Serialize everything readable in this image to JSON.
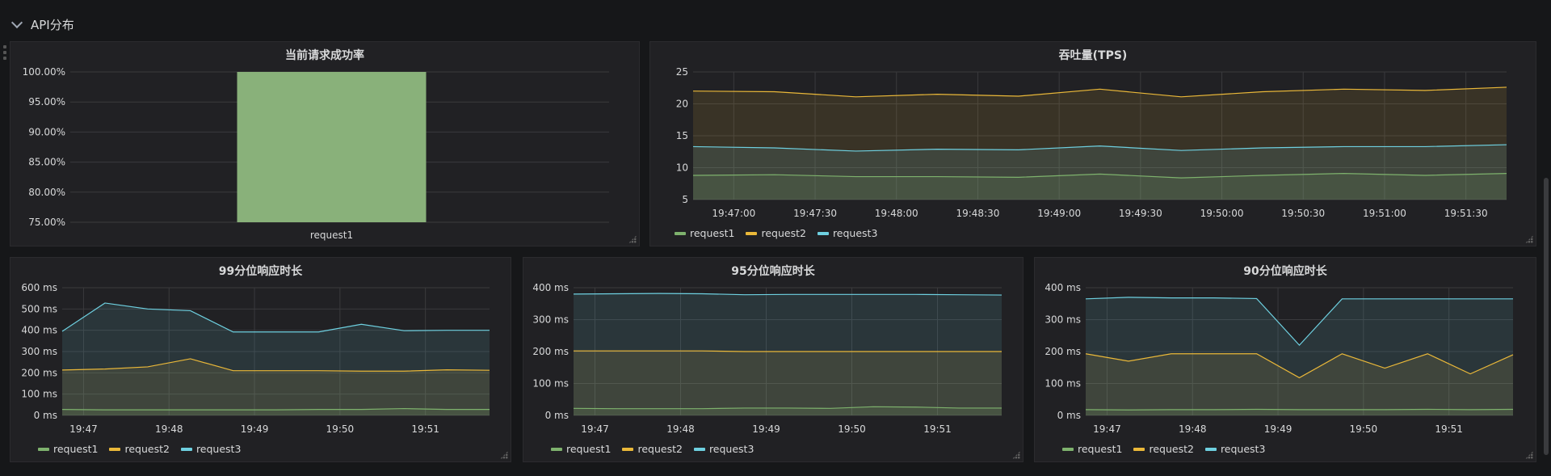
{
  "row": {
    "title": "API分布"
  },
  "colors": {
    "request1": "#7eb26d",
    "request2": "#eab839",
    "request3": "#6ed0e0",
    "bar": "#89b17a"
  },
  "chart_data": [
    {
      "type": "bar",
      "title": "当前请求成功率",
      "categories": [
        "request1"
      ],
      "values": [
        100
      ],
      "ylim": [
        75,
        100
      ],
      "yticks": [
        "75.00%",
        "80.00%",
        "85.00%",
        "90.00%",
        "95.00%",
        "100.00%"
      ],
      "ytick_values": [
        75,
        80,
        85,
        90,
        95,
        100
      ]
    },
    {
      "type": "line",
      "title": "吞吐量(TPS)",
      "x": [
        "19:46:45",
        "19:47:15",
        "19:47:45",
        "19:48:15",
        "19:48:45",
        "19:49:15",
        "19:49:45",
        "19:50:15",
        "19:50:45",
        "19:51:15",
        "19:51:45"
      ],
      "xticks": [
        "19:47:00",
        "19:47:30",
        "19:48:00",
        "19:48:30",
        "19:49:00",
        "19:49:30",
        "19:50:00",
        "19:50:30",
        "19:51:00",
        "19:51:30"
      ],
      "yticks": [
        "5",
        "10",
        "15",
        "20",
        "25"
      ],
      "ytick_values": [
        5,
        10,
        15,
        20,
        25
      ],
      "ylim": [
        5,
        25
      ],
      "series": [
        {
          "name": "request1",
          "values": [
            8.8,
            8.9,
            8.6,
            8.6,
            8.5,
            9.0,
            8.4,
            8.8,
            9.1,
            8.8,
            9.1
          ]
        },
        {
          "name": "request2",
          "values": [
            22.0,
            21.9,
            21.1,
            21.5,
            21.2,
            22.3,
            21.1,
            21.9,
            22.3,
            22.1,
            22.6
          ]
        },
        {
          "name": "request3",
          "values": [
            13.3,
            13.1,
            12.6,
            12.9,
            12.8,
            13.4,
            12.7,
            13.1,
            13.3,
            13.3,
            13.6
          ]
        }
      ]
    },
    {
      "type": "line",
      "title": "99分位响应时长",
      "x": [
        "19:46:45",
        "19:47:15",
        "19:47:45",
        "19:48:15",
        "19:48:45",
        "19:49:15",
        "19:49:45",
        "19:50:15",
        "19:50:45",
        "19:51:15",
        "19:51:45"
      ],
      "xticks": [
        "19:47",
        "19:48",
        "19:49",
        "19:50",
        "19:51"
      ],
      "yticks": [
        "0 ms",
        "100 ms",
        "200 ms",
        "300 ms",
        "400 ms",
        "500 ms",
        "600 ms"
      ],
      "ytick_values": [
        0,
        100,
        200,
        300,
        400,
        500,
        600
      ],
      "ylim": [
        0,
        600
      ],
      "series": [
        {
          "name": "request1",
          "values": [
            28,
            26,
            26,
            26,
            26,
            26,
            28,
            28,
            32,
            28,
            28
          ]
        },
        {
          "name": "request2",
          "values": [
            213,
            218,
            228,
            266,
            210,
            210,
            210,
            208,
            208,
            214,
            212
          ]
        },
        {
          "name": "request3",
          "values": [
            395,
            528,
            500,
            492,
            392,
            392,
            392,
            428,
            398,
            400,
            400
          ]
        }
      ]
    },
    {
      "type": "line",
      "title": "95分位响应时长",
      "x": [
        "19:46:45",
        "19:47:15",
        "19:47:45",
        "19:48:15",
        "19:48:45",
        "19:49:15",
        "19:49:45",
        "19:50:15",
        "19:50:45",
        "19:51:15",
        "19:51:45"
      ],
      "xticks": [
        "19:47",
        "19:48",
        "19:49",
        "19:50",
        "19:51"
      ],
      "yticks": [
        "0 ms",
        "100 ms",
        "200 ms",
        "300 ms",
        "400 ms"
      ],
      "ytick_values": [
        0,
        100,
        200,
        300,
        400
      ],
      "ylim": [
        0,
        400
      ],
      "series": [
        {
          "name": "request1",
          "values": [
            22,
            21,
            21,
            21,
            23,
            23,
            22,
            27,
            26,
            23,
            23
          ]
        },
        {
          "name": "request2",
          "values": [
            202,
            202,
            202,
            202,
            200,
            200,
            200,
            200,
            200,
            200,
            200
          ]
        },
        {
          "name": "request3",
          "values": [
            380,
            381,
            382,
            381,
            378,
            379,
            379,
            379,
            379,
            378,
            377
          ]
        }
      ]
    },
    {
      "type": "line",
      "title": "90分位响应时长",
      "x": [
        "19:46:45",
        "19:47:15",
        "19:47:45",
        "19:48:15",
        "19:48:45",
        "19:49:15",
        "19:49:45",
        "19:50:15",
        "19:50:45",
        "19:51:15",
        "19:51:45"
      ],
      "xticks": [
        "19:47",
        "19:48",
        "19:49",
        "19:50",
        "19:51"
      ],
      "yticks": [
        "0 ms",
        "100 ms",
        "200 ms",
        "300 ms",
        "400 ms"
      ],
      "ytick_values": [
        0,
        100,
        200,
        300,
        400
      ],
      "ylim": [
        0,
        400
      ],
      "series": [
        {
          "name": "request1",
          "values": [
            18,
            17,
            18,
            18,
            19,
            18,
            18,
            18,
            19,
            18,
            19
          ]
        },
        {
          "name": "request2",
          "values": [
            193,
            170,
            193,
            193,
            193,
            118,
            193,
            148,
            193,
            130,
            190
          ]
        },
        {
          "name": "request3",
          "values": [
            365,
            370,
            368,
            368,
            366,
            220,
            365,
            365,
            365,
            365,
            365
          ]
        }
      ]
    }
  ]
}
